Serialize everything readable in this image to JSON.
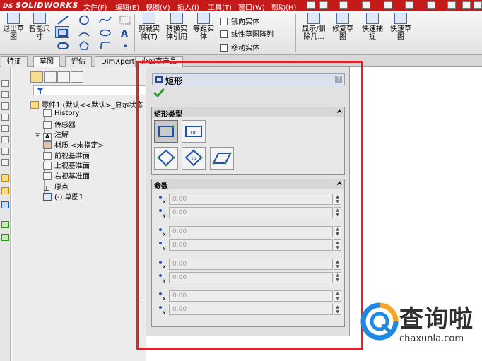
{
  "app": {
    "brand_prefix": "DS",
    "brand": "SOLIDWORKS"
  },
  "menu": [
    "文件(F)",
    "编辑(E)",
    "视图(V)",
    "插入(I)",
    "工具(T)",
    "窗口(W)",
    "帮助(H)"
  ],
  "toolbar": {
    "exit_sketch": "退出草图",
    "smart_dimension": "智能尺寸",
    "trim_entities": "剪裁实体(T)",
    "convert_entities": "转换实体引用",
    "offset_entities": "等距实体",
    "mirror_entities": "镜向实体",
    "linear_pattern": "线性草图阵列",
    "move_entities": "移动实体",
    "display_delete_relations": "显示/删除几...",
    "repair_sketch": "修复草图",
    "quick_snaps": "快速捕捉",
    "rapid_sketch": "快速草图"
  },
  "tabs": [
    "特征",
    "草图",
    "评估",
    "DimXpert",
    "办公室产品"
  ],
  "active_tab": "草图",
  "tree": {
    "part_name": "零件1 (默认<<默认>_显示状态",
    "items": [
      {
        "label": "History",
        "icon": "history-icon"
      },
      {
        "label": "传感器",
        "icon": "sensor-icon"
      },
      {
        "label": "注解",
        "icon": "annotation-icon"
      },
      {
        "label": "材质 <未指定>",
        "icon": "material-icon"
      },
      {
        "label": "前视基准面",
        "icon": "plane-icon"
      },
      {
        "label": "上视基准面",
        "icon": "plane-icon"
      },
      {
        "label": "右视基准面",
        "icon": "plane-icon"
      },
      {
        "label": "原点",
        "icon": "origin-icon"
      },
      {
        "label": "(-) 草图1",
        "icon": "sketch-icon"
      }
    ]
  },
  "property_manager": {
    "title": "矩形",
    "help": "?",
    "rect_type_group": "矩形类型",
    "params_group": "参数",
    "collapse_symbol": "⮝",
    "params": [
      "0.00",
      "0.00",
      "0.00",
      "0.00",
      "0.00",
      "0.00",
      "0.00",
      "0.00"
    ]
  },
  "watermark": {
    "cn": "查询啦",
    "en": "chaxunla.com"
  }
}
